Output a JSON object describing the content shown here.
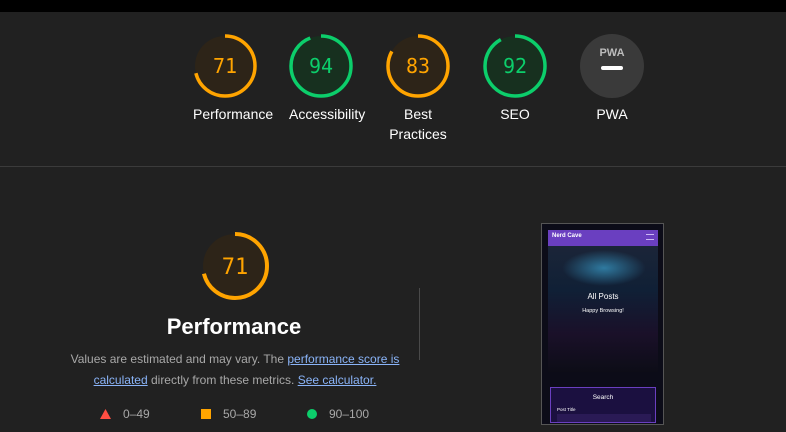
{
  "colors": {
    "average": "#ffa400",
    "pass": "#0cce6b",
    "fail": "#ff4e42",
    "na": "#9e9e9e",
    "link": "#8ab4f8"
  },
  "summary": [
    {
      "id": "performance",
      "score": 71,
      "label": "Performance",
      "rating": "average"
    },
    {
      "id": "accessibility",
      "score": 94,
      "label": "Accessibility",
      "rating": "pass"
    },
    {
      "id": "best-practices",
      "score": 83,
      "label": "Best Practices",
      "rating": "average"
    },
    {
      "id": "seo",
      "score": 92,
      "label": "SEO",
      "rating": "pass"
    },
    {
      "id": "pwa",
      "score": null,
      "label": "PWA",
      "badge": "PWA",
      "icon": "pwa-badge-icon"
    }
  ],
  "performance": {
    "score": 71,
    "title": "Performance",
    "desc_prefix": "Values are estimated and may vary. The ",
    "link_score": "performance score is calculated",
    "desc_middle": " directly from these metrics. ",
    "link_calculator": "See calculator."
  },
  "legend": [
    {
      "range": "0–49",
      "icon": "triangle-icon"
    },
    {
      "range": "50–89",
      "icon": "square-icon"
    },
    {
      "range": "90–100",
      "icon": "circle-icon"
    }
  ],
  "screenshot": {
    "brand": "Nerd Cave",
    "hero_title": "All Posts",
    "hero_subtitle": "Happy Browsing!",
    "card_title": "Search",
    "card_post": "Post Title"
  }
}
